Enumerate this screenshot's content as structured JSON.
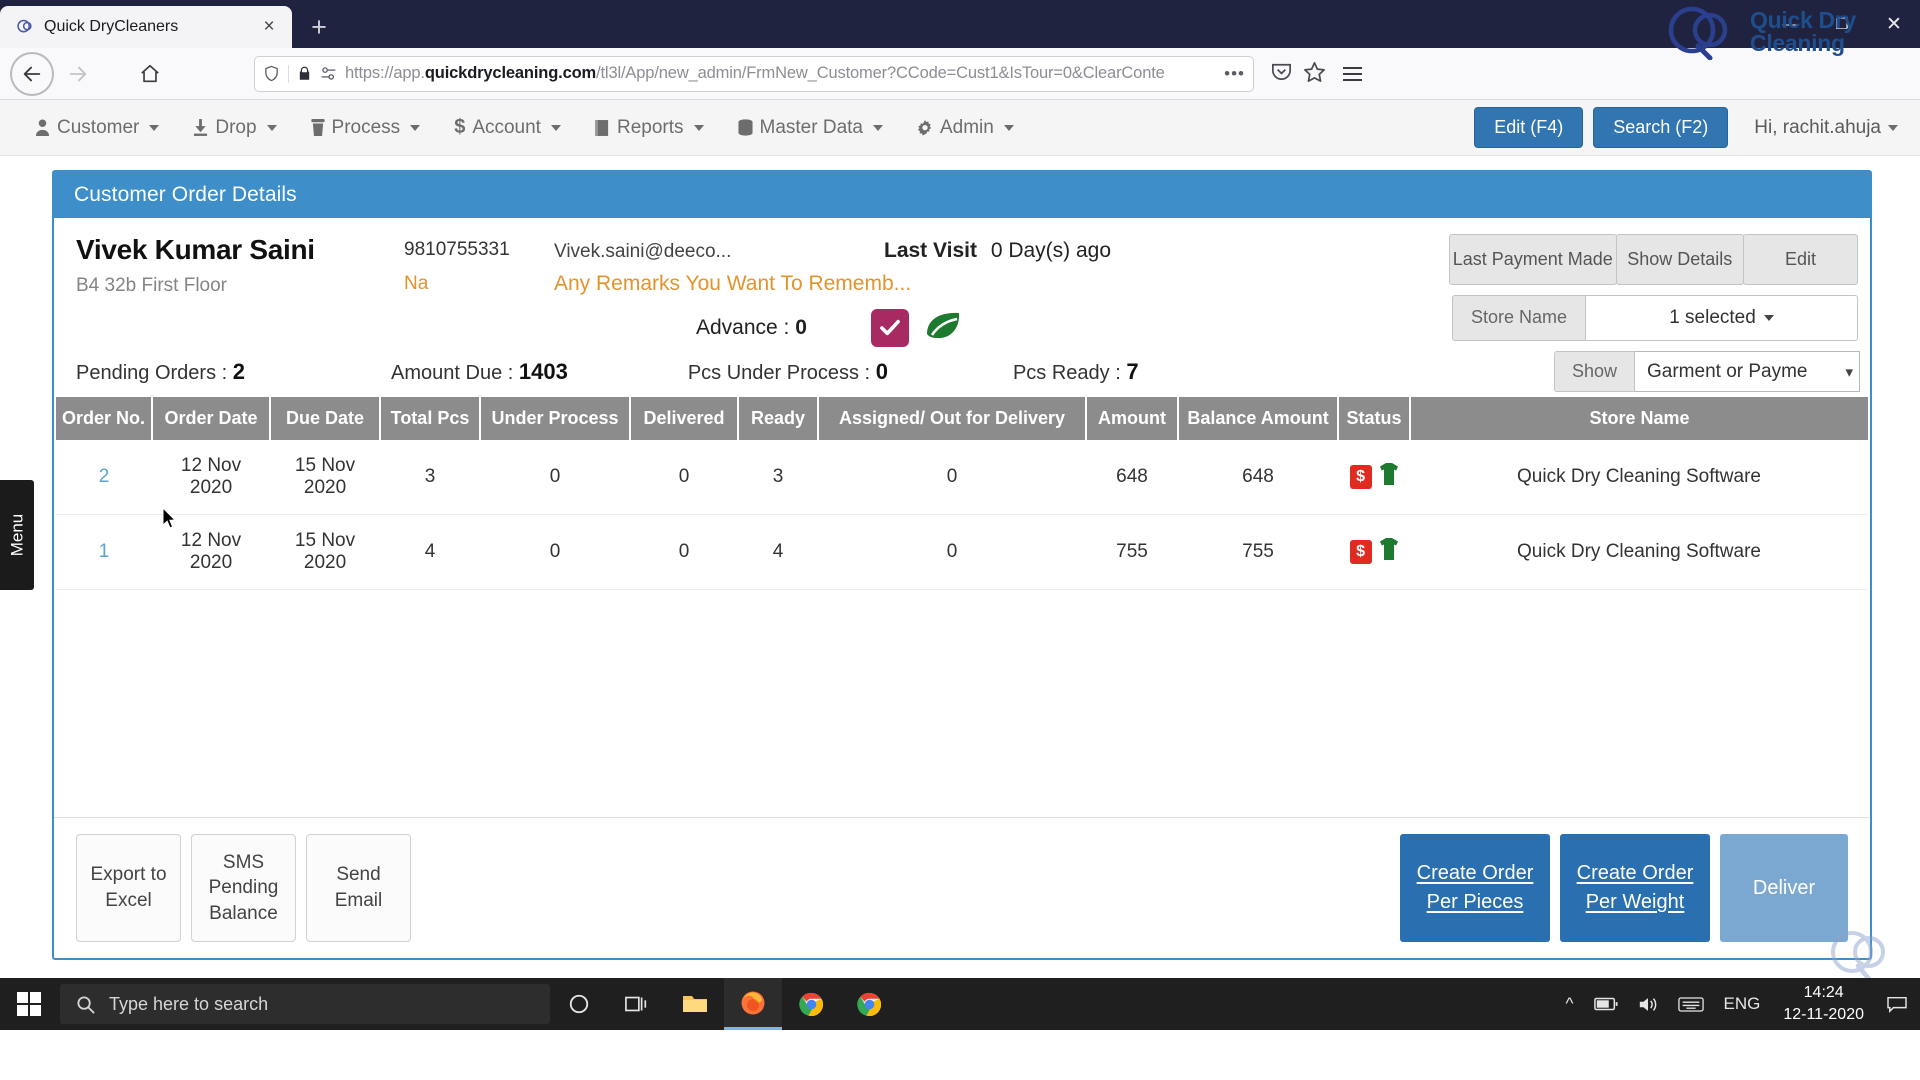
{
  "browser": {
    "tab_title": "Quick DryCleaners",
    "tab_favicon_name": "quickdry-favicon",
    "new_tab_label": "+",
    "close_tab_label": "×",
    "window_minimize": "—",
    "window_maximize": "❐",
    "window_close": "✕",
    "url_scheme": "https://app.",
    "url_host": "quickdrycleaning.com",
    "url_path": "/tl3l/App/new_admin/FrmNew_Customer?CCode=Cust1&IsTour=0&ClearConte",
    "overflow_label": "•••"
  },
  "brand": {
    "line1": "Quick Dry",
    "line2": "Cleaning"
  },
  "appnav": {
    "items": [
      {
        "label": "Customer",
        "icon": "user-icon",
        "caret": true
      },
      {
        "label": "Drop",
        "icon": "download-icon",
        "caret": true
      },
      {
        "label": "Process",
        "icon": "trash-icon",
        "caret": true
      },
      {
        "label": "Account",
        "icon": "dollar-icon",
        "caret": true
      },
      {
        "label": "Reports",
        "icon": "book-icon",
        "caret": true
      },
      {
        "label": "Master Data",
        "icon": "database-icon",
        "caret": true
      },
      {
        "label": "Admin",
        "icon": "gear-icon",
        "caret": true
      }
    ],
    "edit_button": "Edit (F4)",
    "search_button": "Search (F2)",
    "user_greeting": "Hi, rachit.ahuja"
  },
  "panel": {
    "header_title": "Customer Order Details",
    "customer": {
      "name": "Vivek Kumar Saini",
      "address": "B4 32b First Floor",
      "phone": "9810755331",
      "phone_alt": "Na",
      "email": "Vivek.saini@deeco...",
      "remarks": "Any Remarks You Want To Rememb...",
      "last_visit_label": "Last Visit",
      "last_visit_value": "0 Day(s) ago",
      "advance_label": "Advance :",
      "advance_value": "0"
    },
    "actions": {
      "last_payment_made": "Last Payment Made",
      "show_details": "Show Details",
      "edit": "Edit",
      "store_name_label": "Store Name",
      "store_name_value": "1 selected"
    },
    "stats": [
      {
        "label": "Pending Orders :",
        "value": "2"
      },
      {
        "label": "Amount Due :",
        "value": "1403"
      },
      {
        "label": "Pcs Under Process :",
        "value": "0"
      },
      {
        "label": "Pcs Ready :",
        "value": "7"
      }
    ],
    "show_filter": {
      "label": "Show",
      "value": "Garment or Payme"
    },
    "table": {
      "columns": [
        "Order No.",
        "Order Date",
        "Due Date",
        "Total Pcs",
        "Under Process",
        "Delivered",
        "Ready",
        "Assigned/ Out for Delivery",
        "Amount",
        "Balance Amount",
        "Status",
        "Store Name"
      ],
      "rows": [
        {
          "order_no": "2",
          "order_date": "12 Nov 2020",
          "due_date": "15 Nov 2020",
          "total_pcs": "3",
          "under_process": "0",
          "delivered": "0",
          "ready": "3",
          "assigned": "0",
          "amount": "648",
          "balance_amount": "648",
          "status_icons": [
            "payment-due-icon",
            "garment-icon"
          ],
          "store_name": "Quick Dry Cleaning Software"
        },
        {
          "order_no": "1",
          "order_date": "12 Nov 2020",
          "due_date": "15 Nov 2020",
          "total_pcs": "4",
          "under_process": "0",
          "delivered": "0",
          "ready": "4",
          "assigned": "0",
          "amount": "755",
          "balance_amount": "755",
          "status_icons": [
            "payment-due-icon",
            "garment-icon"
          ],
          "store_name": "Quick Dry Cleaning Software"
        }
      ]
    },
    "footer": {
      "export_excel": "Export to Excel",
      "sms_pending_balance": "SMS Pending Balance",
      "send_email": "Send Email",
      "create_order_pieces_l1": "Create Order",
      "create_order_pieces_l2": "Per Pieces",
      "create_order_weight_l1": "Create Order",
      "create_order_weight_l2": "Per Weight",
      "deliver": "Deliver"
    }
  },
  "side_menu_label": "Menu",
  "taskbar": {
    "search_placeholder": "Type here to search",
    "language": "ENG",
    "time": "14:24",
    "date": "12-11-2020",
    "icons": [
      "start-icon",
      "search-icon",
      "cortana-icon",
      "task-view-icon",
      "file-explorer-icon",
      "firefox-icon",
      "chrome-icon",
      "chrome-icon-2"
    ]
  },
  "colors": {
    "accent_blue": "#3d8ec9",
    "button_blue": "#3276b1",
    "orange_text": "#e2942c",
    "table_header_grey": "#8c8c8c",
    "status_red": "#e02b20",
    "status_green": "#1d7a2e",
    "badge_magenta": "#a72a62"
  }
}
